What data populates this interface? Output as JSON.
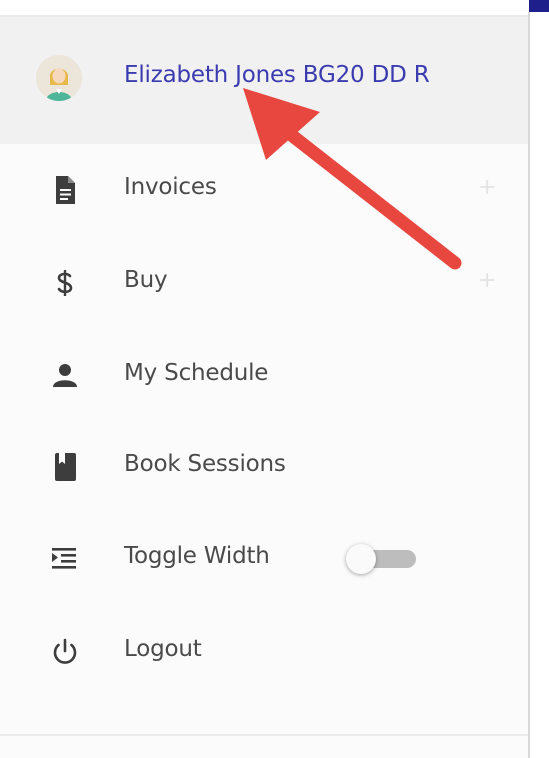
{
  "profile": {
    "name": "Elizabeth Jones BG20 DD R"
  },
  "menu": {
    "items": [
      {
        "id": "invoices",
        "label": "Invoices",
        "icon": "document-icon",
        "expandable": true
      },
      {
        "id": "buy",
        "label": "Buy",
        "icon": "dollar-icon",
        "expandable": true
      },
      {
        "id": "my-schedule",
        "label": "My Schedule",
        "icon": "person-icon",
        "expandable": false
      },
      {
        "id": "book-sessions",
        "label": "Book Sessions",
        "icon": "book-icon",
        "expandable": false
      },
      {
        "id": "toggle-width",
        "label": "Toggle Width",
        "icon": "indent-icon",
        "expandable": false,
        "toggle_state": "off"
      },
      {
        "id": "logout",
        "label": "Logout",
        "icon": "power-icon",
        "expandable": false
      }
    ],
    "expand_symbol": "+"
  },
  "colors": {
    "profile_name": "#3b3bb0",
    "menu_label": "#4a4a4a",
    "icon": "#3d3d3d",
    "annotation_arrow": "#e8473f",
    "accent": "#1f1f8c"
  }
}
